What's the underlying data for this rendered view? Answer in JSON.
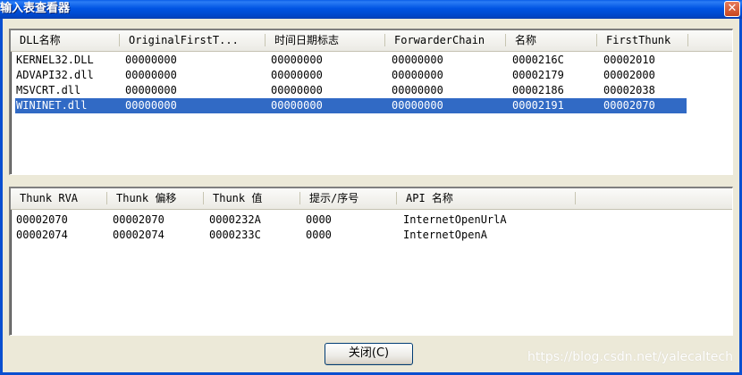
{
  "window": {
    "title": "输入表查看器",
    "close_glyph": "✕"
  },
  "dll_table": {
    "columns": [
      "DLL名称",
      "OriginalFirstT...",
      "时间日期标志",
      "ForwarderChain",
      "名称",
      "FirstThunk"
    ],
    "rows": [
      [
        "KERNEL32.DLL",
        "00000000",
        "00000000",
        "00000000",
        "0000216C",
        "00002010"
      ],
      [
        "ADVAPI32.dll",
        "00000000",
        "00000000",
        "00000000",
        "00002179",
        "00002000"
      ],
      [
        "MSVCRT.dll",
        "00000000",
        "00000000",
        "00000000",
        "00002186",
        "00002038"
      ],
      [
        "WININET.dll",
        "00000000",
        "00000000",
        "00000000",
        "00002191",
        "00002070"
      ]
    ],
    "selected_row": "WININET.dll"
  },
  "thunk_table": {
    "columns": [
      "Thunk RVA",
      "Thunk 偏移",
      "Thunk 值",
      "提示/序号",
      "API 名称"
    ],
    "rows": [
      [
        "00002070",
        "00002070",
        "0000232A",
        "0000",
        "InternetOpenUrlA"
      ],
      [
        "00002074",
        "00002074",
        "0000233C",
        "0000",
        "InternetOpenA"
      ]
    ]
  },
  "buttons": {
    "close_label": "关闭(C)"
  },
  "watermark": "https://blog.csdn.net/yalecaltech",
  "colors": {
    "selection": "#316ac5",
    "title_bar": "#0054e3",
    "dialog_bg": "#ece9d8"
  }
}
